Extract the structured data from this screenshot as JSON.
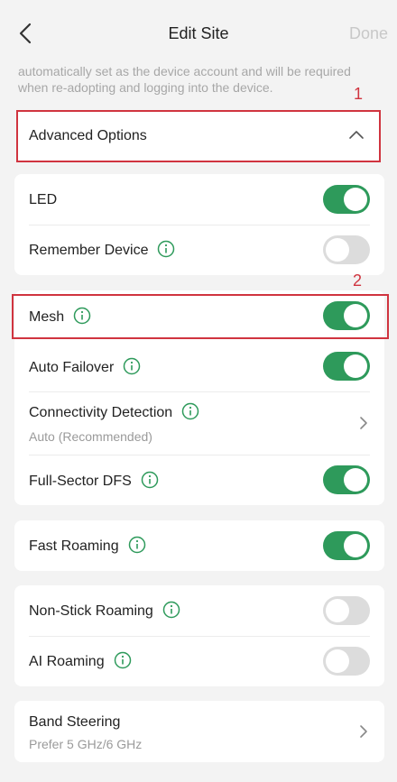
{
  "header": {
    "title": "Edit Site",
    "done_label": "Done"
  },
  "description": "automatically set as the device account and will be required when re-adopting and logging into the device.",
  "annotations": {
    "marker_1": "1",
    "marker_2": "2"
  },
  "advanced": {
    "label": "Advanced Options"
  },
  "items": {
    "led": {
      "label": "LED",
      "on": true
    },
    "remember": {
      "label": "Remember Device",
      "on": false
    },
    "mesh": {
      "label": "Mesh",
      "on": true
    },
    "failover": {
      "label": "Auto Failover",
      "on": true
    },
    "connectivity": {
      "label": "Connectivity Detection",
      "value": "Auto (Recommended)"
    },
    "dfs": {
      "label": "Full-Sector DFS",
      "on": true
    },
    "fast_roaming": {
      "label": "Fast Roaming",
      "on": true
    },
    "non_stick": {
      "label": "Non-Stick Roaming",
      "on": false
    },
    "ai_roaming": {
      "label": "AI Roaming",
      "on": false
    },
    "band_steering": {
      "label": "Band Steering",
      "value": "Prefer 5 GHz/6 GHz"
    }
  },
  "colors": {
    "accent": "#2e9a5b",
    "annotation": "#d0343f",
    "toggle_off": "#dcdcdc"
  },
  "icons": [
    "back-arrow-icon",
    "chevron-up-icon",
    "info-icon",
    "chevron-right-icon"
  ]
}
